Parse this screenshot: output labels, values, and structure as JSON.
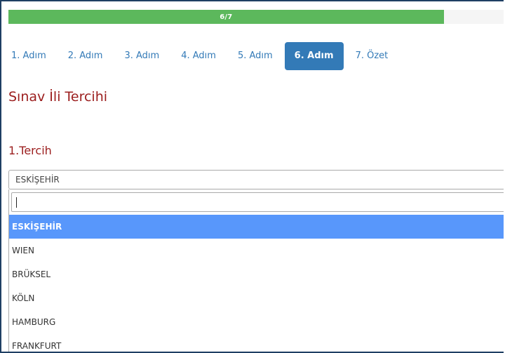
{
  "progress": {
    "text": "6/7",
    "fraction": 0.862
  },
  "steps": [
    {
      "label": "1. Adım"
    },
    {
      "label": "2. Adım"
    },
    {
      "label": "3. Adım"
    },
    {
      "label": "4. Adım"
    },
    {
      "label": "5. Adım"
    },
    {
      "label": "6. Adım",
      "active": true
    },
    {
      "label": "7. Özet"
    }
  ],
  "page": {
    "title": "Sınav İli Tercihi",
    "subtitle": "1.Tercih"
  },
  "select": {
    "value": "ESKİŞEHİR",
    "search_value": "",
    "options": [
      "ESKİŞEHİR",
      "WIEN",
      "BRÜKSEL",
      "KÖLN",
      "HAMBURG",
      "FRANKFURT"
    ],
    "highlighted": "ESKİŞEHİR"
  },
  "colors": {
    "progress": "#5cb85c",
    "tab_active": "#337ab7",
    "heading": "#9b1d1d",
    "highlight": "#5897fb"
  }
}
